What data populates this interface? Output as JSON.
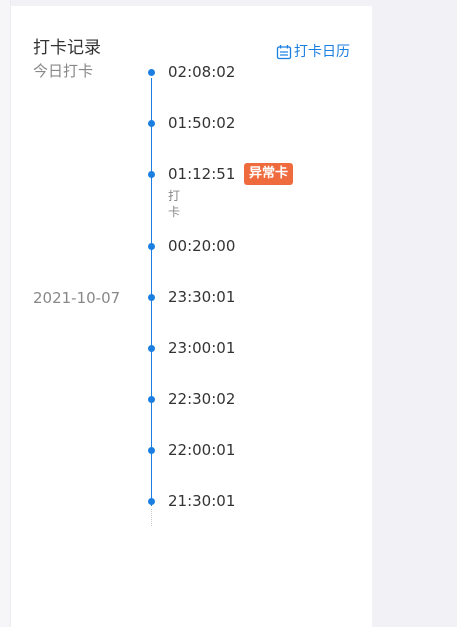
{
  "header": {
    "title": "打卡记录",
    "calendar_label": "打卡日历",
    "calendar_icon": "calendar-icon"
  },
  "groups": [
    {
      "date_label": "今日打卡"
    },
    {
      "date_label": "2021-10-07"
    }
  ],
  "records": [
    {
      "time": "02:08:02"
    },
    {
      "time": "01:50:02"
    },
    {
      "time": "01:12:51",
      "badge": "异常卡",
      "note": "打卡"
    },
    {
      "time": "00:20:00"
    },
    {
      "time": "23:30:01"
    },
    {
      "time": "23:00:01"
    },
    {
      "time": "22:30:02"
    },
    {
      "time": "22:00:01"
    },
    {
      "time": "21:30:01"
    }
  ],
  "colors": {
    "accent": "#1a7fe0",
    "badge": "#ef6b3e"
  }
}
